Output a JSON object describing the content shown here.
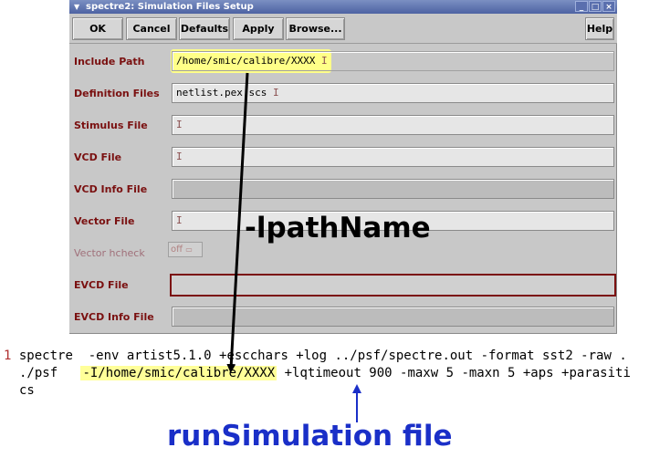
{
  "window": {
    "title": "spectre2: Simulation Files Setup",
    "controls": [
      "_",
      "□",
      "×"
    ]
  },
  "toolbar": {
    "ok": "OK",
    "cancel": "Cancel",
    "defaults": "Defaults",
    "apply": "Apply",
    "browse": "Browse...",
    "help": "Help"
  },
  "rows": {
    "include_path": {
      "label": "Include Path",
      "value": "/home/smic/calibre/XXXX"
    },
    "definition_files": {
      "label": "Definition Files",
      "value": "netlist.pex.scs"
    },
    "stimulus_file": {
      "label": "Stimulus File",
      "value": ""
    },
    "vcd_file": {
      "label": "VCD File",
      "value": ""
    },
    "vcd_info_file": {
      "label": "VCD Info File",
      "value": ""
    },
    "vector_file": {
      "label": "Vector File",
      "value": ""
    },
    "vector_hcheck": {
      "label": "Vector hcheck",
      "value": "off"
    },
    "evcd_file": {
      "label": "EVCD File",
      "value": ""
    },
    "evcd_info_file": {
      "label": "EVCD Info File",
      "value": ""
    }
  },
  "command": {
    "line_number": "1",
    "line1": "spectre  -env artist5.1.0 +escchars +log ../psf/spectre.out -format sst2 -raw .",
    "line2_prefix": "./psf   ",
    "line2_highlight": "-I/home/smic/calibre/XXXX",
    "line2_suffix": " +lqtimeout 900 -maxw 5 -maxn 5 +aps +parasiti",
    "line3": "cs"
  },
  "annotations": {
    "lpath": "-lpathName",
    "run_file": "runSimulation file",
    "run_color": "#1a2fc8"
  }
}
